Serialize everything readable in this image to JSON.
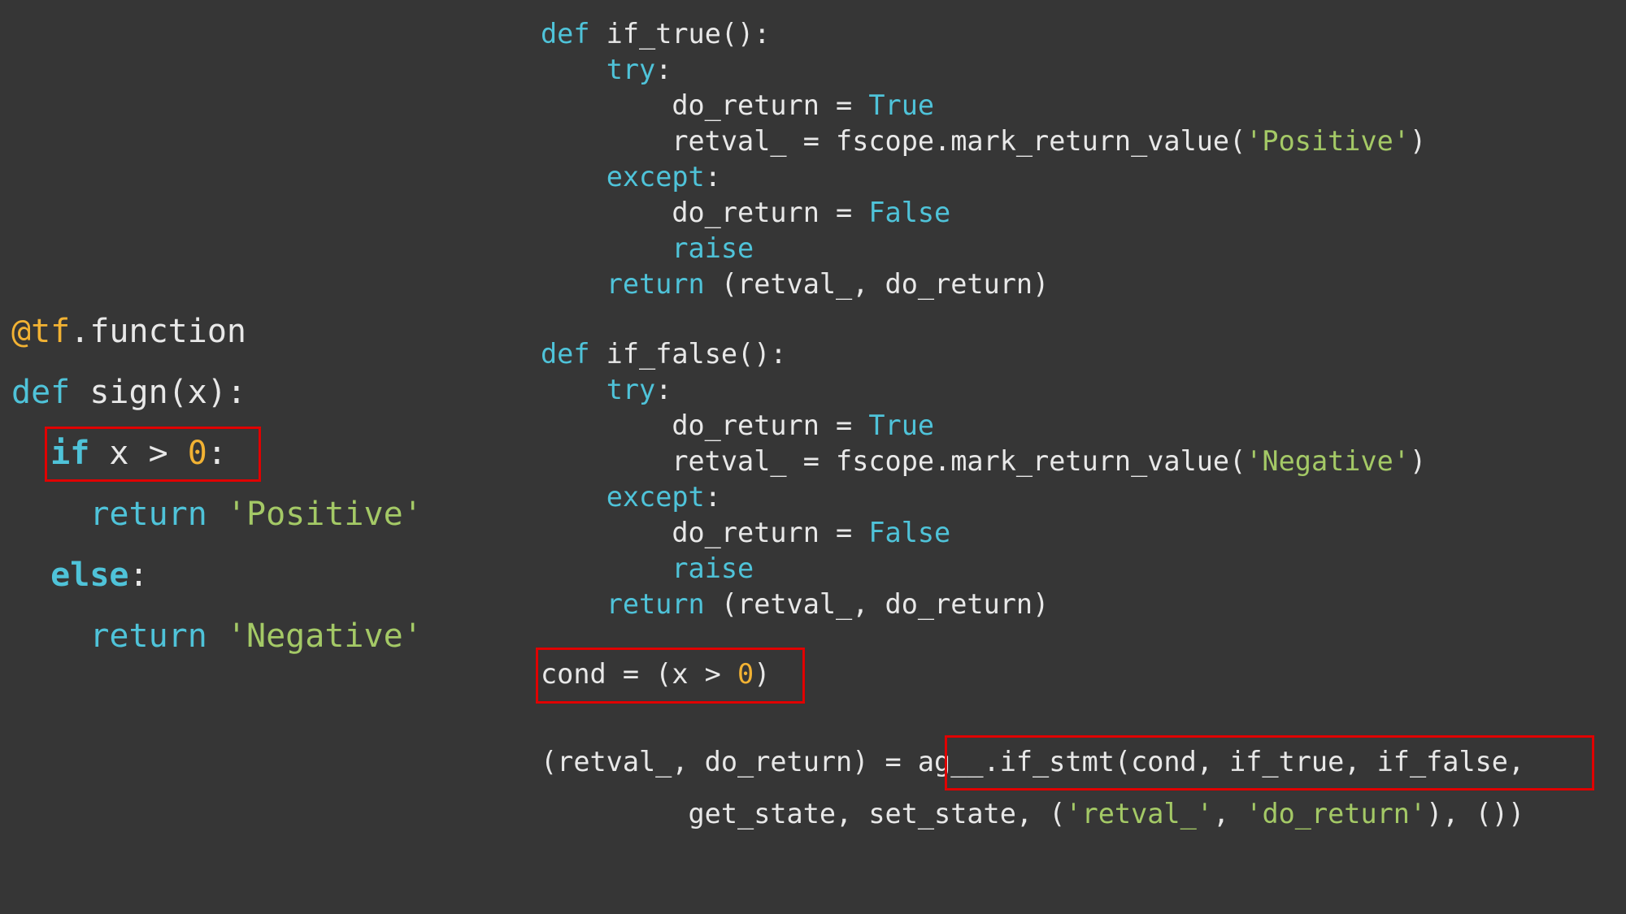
{
  "colors": {
    "background": "#363636",
    "keyword": "#4fc3d9",
    "number_decorator": "#f2b233",
    "string": "#a4c966",
    "text": "#e8e8e8",
    "highlight": "#e00000"
  },
  "left_code": [
    [
      [
        "dec",
        "@tf"
      ],
      [
        "plain",
        ".function"
      ]
    ],
    [
      [
        "kw",
        "def"
      ],
      [
        "plain",
        " sign(x):"
      ]
    ],
    [
      [
        "plain",
        "  "
      ],
      [
        "kwb",
        "if"
      ],
      [
        "plain",
        " x > "
      ],
      [
        "num",
        "0"
      ],
      [
        "plain",
        ":"
      ]
    ],
    [
      [
        "plain",
        "    "
      ],
      [
        "kw",
        "return"
      ],
      [
        "plain",
        " "
      ],
      [
        "str",
        "'Positive'"
      ]
    ],
    [
      [
        "plain",
        "  "
      ],
      [
        "kwb",
        "else"
      ],
      [
        "plain",
        ":"
      ]
    ],
    [
      [
        "plain",
        "    "
      ],
      [
        "kw",
        "return"
      ],
      [
        "plain",
        " "
      ],
      [
        "str",
        "'Negative'"
      ]
    ]
  ],
  "right_code": [
    [
      [
        "kw",
        "def"
      ],
      [
        "plain",
        " if_true():"
      ]
    ],
    [
      [
        "plain",
        "    "
      ],
      [
        "kw",
        "try"
      ],
      [
        "plain",
        ":"
      ]
    ],
    [
      [
        "plain",
        "        do_return = "
      ],
      [
        "kw",
        "True"
      ]
    ],
    [
      [
        "plain",
        "        retval_ = fscope.mark_return_value("
      ],
      [
        "str",
        "'Positive'"
      ],
      [
        "plain",
        ")"
      ]
    ],
    [
      [
        "plain",
        "    "
      ],
      [
        "kw",
        "except"
      ],
      [
        "plain",
        ":"
      ]
    ],
    [
      [
        "plain",
        "        do_return = "
      ],
      [
        "kw",
        "False"
      ]
    ],
    [
      [
        "plain",
        "        "
      ],
      [
        "kw",
        "raise"
      ]
    ],
    [
      [
        "plain",
        "    "
      ],
      [
        "kw",
        "return"
      ],
      [
        "plain",
        " (retval_, do_return)"
      ]
    ],
    [
      [
        "kw",
        "def"
      ],
      [
        "plain",
        " if_false():"
      ]
    ],
    [
      [
        "plain",
        "    "
      ],
      [
        "kw",
        "try"
      ],
      [
        "plain",
        ":"
      ]
    ],
    [
      [
        "plain",
        "        do_return = "
      ],
      [
        "kw",
        "True"
      ]
    ],
    [
      [
        "plain",
        "        retval_ = fscope.mark_return_value("
      ],
      [
        "str",
        "'Negative'"
      ],
      [
        "plain",
        ")"
      ]
    ],
    [
      [
        "plain",
        "    "
      ],
      [
        "kw",
        "except"
      ],
      [
        "plain",
        ":"
      ]
    ],
    [
      [
        "plain",
        "        do_return = "
      ],
      [
        "kw",
        "False"
      ]
    ],
    [
      [
        "plain",
        "        "
      ],
      [
        "kw",
        "raise"
      ]
    ],
    [
      [
        "plain",
        "    "
      ],
      [
        "kw",
        "return"
      ],
      [
        "plain",
        " (retval_, do_return)"
      ]
    ],
    [
      [
        "plain",
        "cond = (x > "
      ],
      [
        "num",
        "0"
      ],
      [
        "plain",
        ")"
      ]
    ],
    [
      [
        "plain",
        "(retval_, do_return) = ag__.if_stmt(cond, if_true, if_false,"
      ]
    ],
    [
      [
        "plain",
        "         get_state, set_state, ("
      ],
      [
        "str",
        "'retval_'"
      ],
      [
        "plain",
        ", "
      ],
      [
        "str",
        "'do_return'"
      ],
      [
        "plain",
        "), ())"
      ]
    ]
  ]
}
